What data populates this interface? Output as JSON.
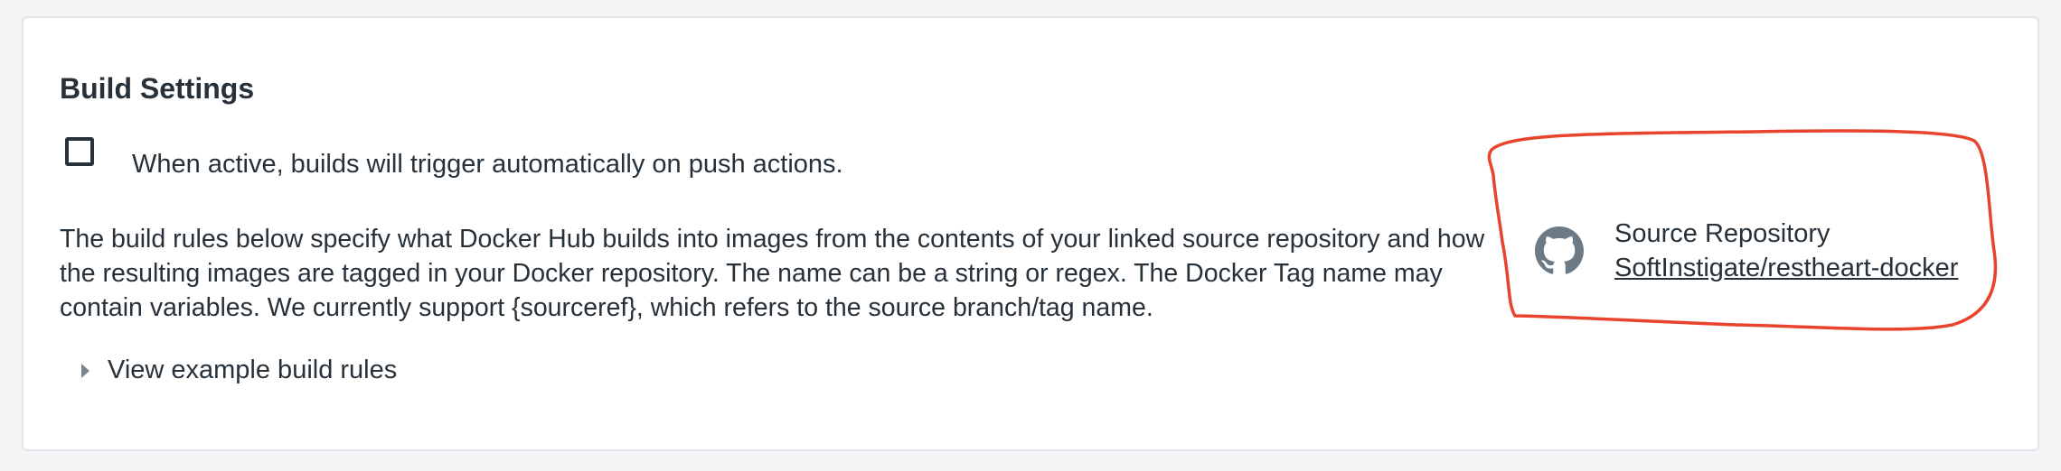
{
  "build_settings": {
    "title": "Build Settings",
    "autobuild": {
      "checked": false,
      "label": "When active, builds will trigger automatically on push actions."
    },
    "description": "The build rules below specify what Docker Hub builds into images from the contents of your linked source repository and how the resulting images are tagged in your Docker repository. The name can be a string or regex. The Docker Tag name may contain variables. We currently support {sourceref}, which refers to the source branch/tag name.",
    "example_toggle_label": "View example build rules"
  },
  "source_repository": {
    "icon": "github-icon",
    "label": "Source Repository",
    "link_text": "SoftInstigate/restheart-docker"
  },
  "colors": {
    "text": "#27313a",
    "annotation": "#e8432d",
    "icon": "#6c7a86"
  }
}
